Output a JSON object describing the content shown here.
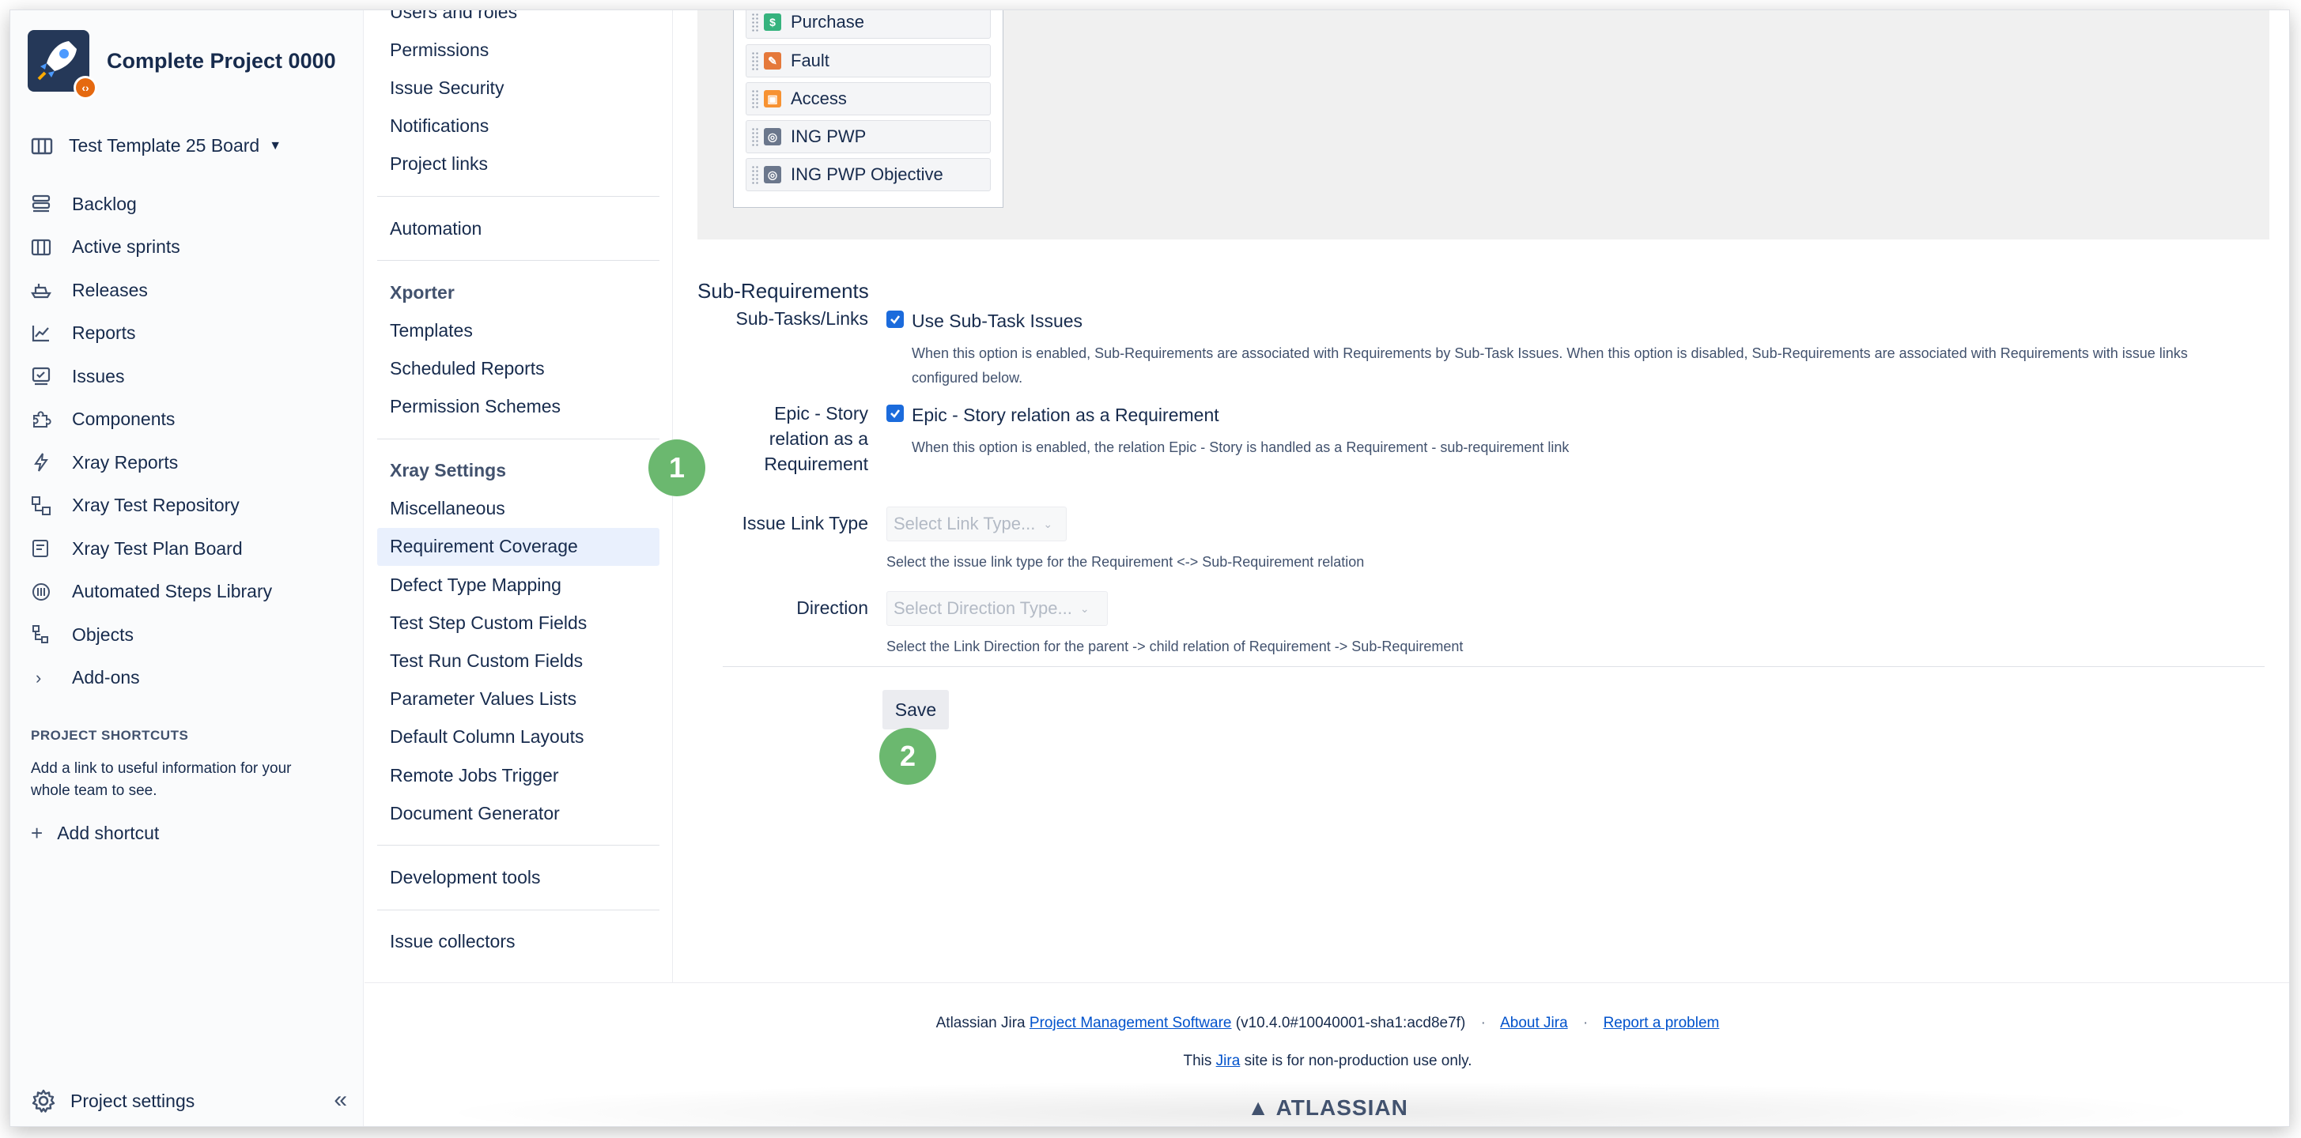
{
  "project": {
    "name": "Complete Project 0000",
    "badge_symbol": "‹›"
  },
  "board": {
    "label": "Test Template 25 Board"
  },
  "nav": {
    "items": [
      {
        "label": "Backlog",
        "icon": "backlog-icon"
      },
      {
        "label": "Active sprints",
        "icon": "board-icon"
      },
      {
        "label": "Releases",
        "icon": "ship-icon"
      },
      {
        "label": "Reports",
        "icon": "chart-icon"
      },
      {
        "label": "Issues",
        "icon": "issues-icon"
      },
      {
        "label": "Components",
        "icon": "puzzle-icon"
      },
      {
        "label": "Xray Reports",
        "icon": "bolt-icon"
      },
      {
        "label": "Xray Test Repository",
        "icon": "repository-icon"
      },
      {
        "label": "Xray Test Plan Board",
        "icon": "plan-icon"
      },
      {
        "label": "Automated Steps Library",
        "icon": "library-icon"
      },
      {
        "label": "Objects",
        "icon": "objects-icon"
      },
      {
        "label": "Add-ons",
        "icon": "chevron-right-icon"
      }
    ]
  },
  "shortcuts": {
    "heading": "PROJECT SHORTCUTS",
    "text": "Add a link to useful information for your whole team to see.",
    "add_label": "Add shortcut"
  },
  "footer_nav": {
    "settings_label": "Project settings"
  },
  "subnav": {
    "top_items": [
      "Users and roles",
      "Permissions",
      "Issue Security",
      "Notifications",
      "Project links"
    ],
    "automation": "Automation",
    "xporter_heading": "Xporter",
    "xporter_items": [
      "Templates",
      "Scheduled Reports",
      "Permission Schemes"
    ],
    "xray_heading": "Xray Settings",
    "xray_items": [
      "Miscellaneous",
      "Requirement Coverage",
      "Defect Type Mapping",
      "Test Step Custom Fields",
      "Test Run Custom Fields",
      "Parameter Values Lists",
      "Default Column Layouts",
      "Remote Jobs Trigger",
      "Document Generator"
    ],
    "dev_tools": "Development tools",
    "issue_collectors": "Issue collectors"
  },
  "issue_types": [
    {
      "label": "Purchase",
      "color": "#36b37e",
      "symbol": "$"
    },
    {
      "label": "Fault",
      "color": "#e5793b",
      "symbol": "✎"
    },
    {
      "label": "Access",
      "color": "#f79232",
      "symbol": "▣"
    },
    {
      "label": "ING PWP",
      "color": "#6b778c",
      "symbol": "◎"
    },
    {
      "label": "ING PWP Objective",
      "color": "#6b778c",
      "symbol": "◎"
    }
  ],
  "sub_requirements": {
    "title": "Sub-Requirements",
    "subtasks_label": "Sub-Tasks/Links",
    "subtasks_checkbox": "Use Sub-Task Issues",
    "subtasks_desc_1": "When this option is enabled, Sub-Requirements are associated with Requirements by Sub-Task Issues. When this option is disabled, Sub-Requirements are associated with Requirements with issue links",
    "subtasks_desc_2": "configured below.",
    "epic_label_1": "Epic - Story",
    "epic_label_2": "relation as a",
    "epic_label_3": "Requirement",
    "epic_checkbox": "Epic - Story relation as a Requirement",
    "epic_desc": "When this option is enabled, the relation Epic - Story is handled as a Requirement - sub-requirement link",
    "link_type_label": "Issue Link Type",
    "link_type_placeholder": "Select Link Type...",
    "link_type_desc": "Select the issue link type for the Requirement <-> Sub-Requirement relation",
    "direction_label": "Direction",
    "direction_placeholder": "Select Direction Type...",
    "direction_desc": "Select the Link Direction for the parent -> child relation of Requirement -> Sub-Requirement",
    "save_label": "Save"
  },
  "steps": {
    "one": "1",
    "two": "2"
  },
  "footer": {
    "prefix": "Atlassian Jira",
    "pms_link": "Project Management Software",
    "version": "(v10.4.0#10040001-sha1:acd8e7f)",
    "about": "About Jira",
    "report": "Report a problem",
    "line2_pre": "This",
    "line2_link": "Jira",
    "line2_post": "site is for non-production use only.",
    "logo": "ATLASSIAN"
  }
}
